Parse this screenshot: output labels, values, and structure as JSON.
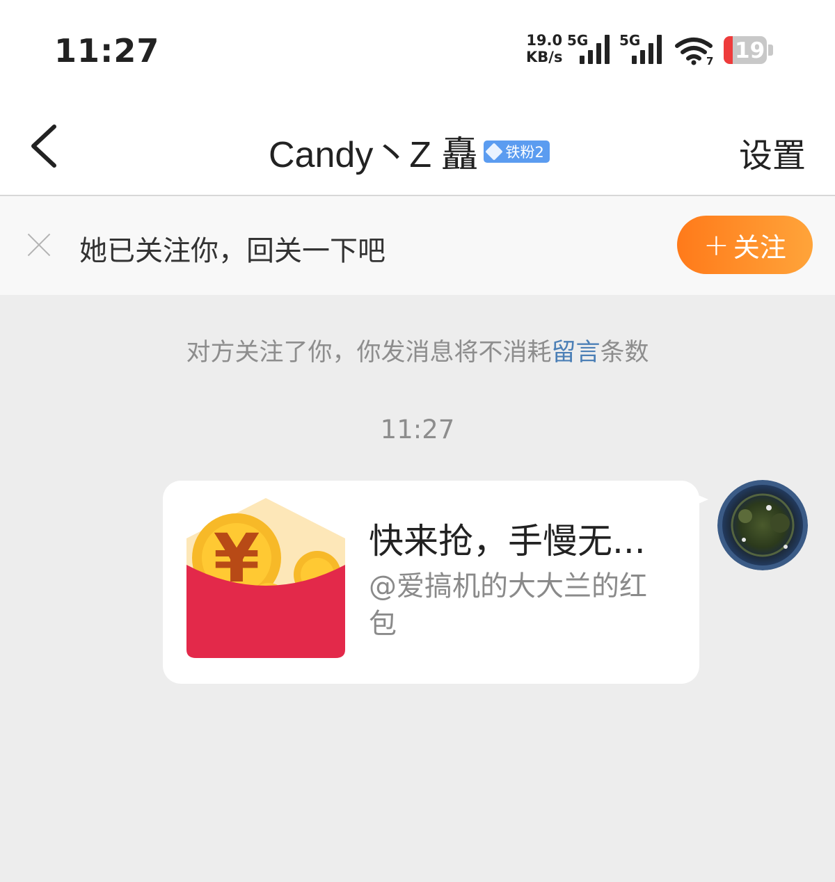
{
  "status_bar": {
    "time": "11:27",
    "net_speed_value": "19.0",
    "net_speed_unit": "KB/s",
    "sim1_network": "5G",
    "sim2_network": "5G",
    "wifi_label": "7",
    "battery_level": "19",
    "icons": [
      "signal-icon",
      "signal-icon",
      "wifi-icon",
      "battery-icon"
    ],
    "battery_low_color": "#ee3b3b"
  },
  "header": {
    "back_icon": "chevron-left-icon",
    "title": "Candy丶Z 矗",
    "badge_label": "铁粉2",
    "badge_color": "#5b9cf0",
    "settings_label": "设置"
  },
  "follow_banner": {
    "close_icon": "close-icon",
    "text": "她已关注你，回关一下吧",
    "button_label": "关注",
    "button_icon": "plus-icon",
    "button_color": "#ff8a22"
  },
  "conversation": {
    "notice_prefix": "对方关注了你，你发消息将不消耗",
    "notice_link": "留言",
    "notice_suffix": "条数",
    "timestamp": "11:27",
    "message": {
      "type": "red-packet",
      "icon": "red-envelope-icon",
      "title": "快来抢，手慢无...",
      "subtitle": "@爱搞机的大大兰的红包"
    }
  }
}
